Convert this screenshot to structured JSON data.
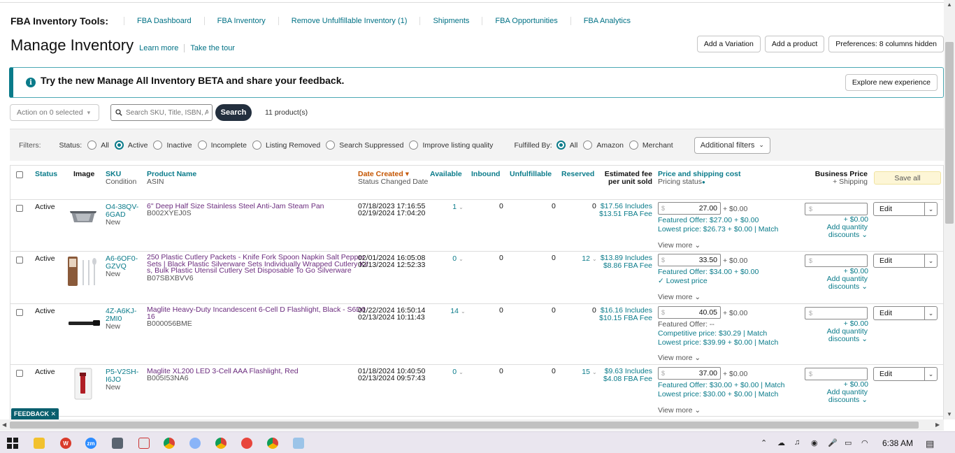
{
  "tools": {
    "title": "FBA Inventory Tools:",
    "links": [
      "FBA Dashboard",
      "FBA Inventory",
      "Remove Unfulfillable Inventory (1)",
      "Shipments",
      "FBA Opportunities",
      "FBA Analytics"
    ]
  },
  "header": {
    "title": "Manage Inventory",
    "learn_more": "Learn more",
    "tour": "Take the tour",
    "add_variation": "Add a Variation",
    "add_product": "Add a product",
    "preferences": "Preferences: 8 columns hidden"
  },
  "banner": {
    "info_icon": "i",
    "message": "Try the new Manage All Inventory BETA and share your feedback.",
    "button": "Explore new experience"
  },
  "actions": {
    "action_select": "Action on 0 selected",
    "search_placeholder": "Search SKU, Title, ISBN, ASIN",
    "search_button": "Search",
    "count": "11 product(s)"
  },
  "filters": {
    "label": "Filters:",
    "status_label": "Status:",
    "status_options": [
      "All",
      "Active",
      "Inactive",
      "Incomplete",
      "Listing Removed",
      "Search Suppressed",
      "Improve listing quality"
    ],
    "status_selected": "Active",
    "fulfilled_label": "Fulfilled By:",
    "fulfilled_options": [
      "All",
      "Amazon",
      "Merchant"
    ],
    "fulfilled_selected": "All",
    "additional": "Additional filters"
  },
  "columns": {
    "status": "Status",
    "image": "Image",
    "sku": "SKU",
    "condition": "Condition",
    "product_name": "Product Name",
    "asin": "ASIN",
    "date_created": "Date Created",
    "status_changed": "Status Changed Date",
    "available": "Available",
    "inbound": "Inbound",
    "unfulfillable": "Unfulfillable",
    "reserved": "Reserved",
    "est_fee": "Estimated fee",
    "per_unit": "per unit sold",
    "price_shipping": "Price and shipping cost",
    "pricing_status": "Pricing status",
    "business_price": "Business Price",
    "plus_shipping": "+ Shipping",
    "save_all": "Save all"
  },
  "rows": [
    {
      "status": "Active",
      "sku": "O4-38QV-6GAD",
      "sku_lines": [
        "O4-38QV-",
        "6GAD"
      ],
      "condition": "New",
      "name_lines": [
        "6\" Deep Half Size Stainless Steel Anti-Jam Steam Pan"
      ],
      "asin": "B002XYEJ0S",
      "created": "07/18/2023 17:16:55",
      "changed": "02/19/2024 17:04:20",
      "available": "1",
      "inbound": "0",
      "unfulfillable": "0",
      "reserved": "0",
      "fee1": "$17.56 Includes",
      "fee2": "$13.51 FBA Fee",
      "price": "27.00",
      "shipping": "+ $0.00",
      "lines": [
        "Featured Offer: $27.00 + $0.00",
        "Lowest price: $26.73 + $0.00 | Match"
      ],
      "view_more": "View more",
      "biz_ship": "+ $0.00",
      "qty1": "Add quantity",
      "qty2": "discounts",
      "edit": "Edit"
    },
    {
      "status": "Active",
      "sku": "A6-6OF0-GZVQ",
      "sku_lines": [
        "A6-6OF0-",
        "GZVQ"
      ],
      "condition": "New",
      "name_lines": [
        "250 Plastic Cutlery Packets - Knife Fork Spoon Napkin Salt Pepper",
        "Sets | Black Plastic Silverware Sets Individually Wrapped Cutlery Kit",
        "s, Bulk Plastic Utensil Cutlery Set Disposable To Go Silverware"
      ],
      "asin": "B07SBXBVV6",
      "created": "02/01/2024 16:05:08",
      "changed": "02/13/2024 12:52:33",
      "available": "0",
      "inbound": "0",
      "unfulfillable": "0",
      "reserved": "12",
      "fee1": "$13.89 Includes",
      "fee2": "$8.86 FBA Fee",
      "price": "33.50",
      "shipping": "+ $0.00",
      "lines": [
        "Featured Offer: $34.00 + $0.00",
        "✓ Lowest price"
      ],
      "view_more": "View more",
      "biz_ship": "+ $0.00",
      "qty1": "Add quantity",
      "qty2": "discounts",
      "edit": "Edit"
    },
    {
      "status": "Active",
      "sku": "4Z-A6KJ-2MI0",
      "sku_lines": [
        "4Z-A6KJ-",
        "2MI0"
      ],
      "condition": "New",
      "name_lines": [
        "Maglite Heavy-Duty Incandescent 6-Cell D Flashlight, Black - S6D0",
        "16"
      ],
      "asin": "B000056BME",
      "created": "01/22/2024 16:50:14",
      "changed": "02/13/2024 10:11:43",
      "available": "14",
      "inbound": "0",
      "unfulfillable": "0",
      "reserved": "0",
      "fee1": "$16.16 Includes",
      "fee2": "$10.15 FBA Fee",
      "price": "40.05",
      "shipping": "+ $0.00",
      "lines": [
        "Featured Offer: --",
        "Competitive price: $30.29 | Match",
        "Lowest price: $39.99 + $0.00 | Match"
      ],
      "view_more": "View more",
      "biz_ship": "+ $0.00",
      "qty1": "Add quantity",
      "qty2": "discounts",
      "edit": "Edit"
    },
    {
      "status": "Active",
      "sku": "P5-V2SH-I6JO",
      "sku_lines": [
        "P5-V2SH-",
        "I6JO"
      ],
      "condition": "New",
      "name_lines": [
        "Maglite XL200 LED 3-Cell AAA Flashlight, Red"
      ],
      "asin": "B005I53NA6",
      "created": "01/18/2024 10:40:50",
      "changed": "02/13/2024 09:57:43",
      "available": "0",
      "inbound": "0",
      "unfulfillable": "0",
      "reserved": "15",
      "fee1": "$9.63 Includes",
      "fee2": "$4.08 FBA Fee",
      "price": "37.00",
      "shipping": "+ $0.00",
      "lines": [
        "Featured Offer: $30.00 + $0.00 | Match",
        "Lowest price: $30.00 + $0.00 | Match"
      ],
      "view_more": "View more",
      "biz_ship": "+ $0.00",
      "qty1": "Add quantity",
      "qty2": "discounts",
      "edit": "Edit"
    }
  ],
  "feedback": "FEEDBACK ✕",
  "taskbar": {
    "time": "6:38 AM"
  }
}
